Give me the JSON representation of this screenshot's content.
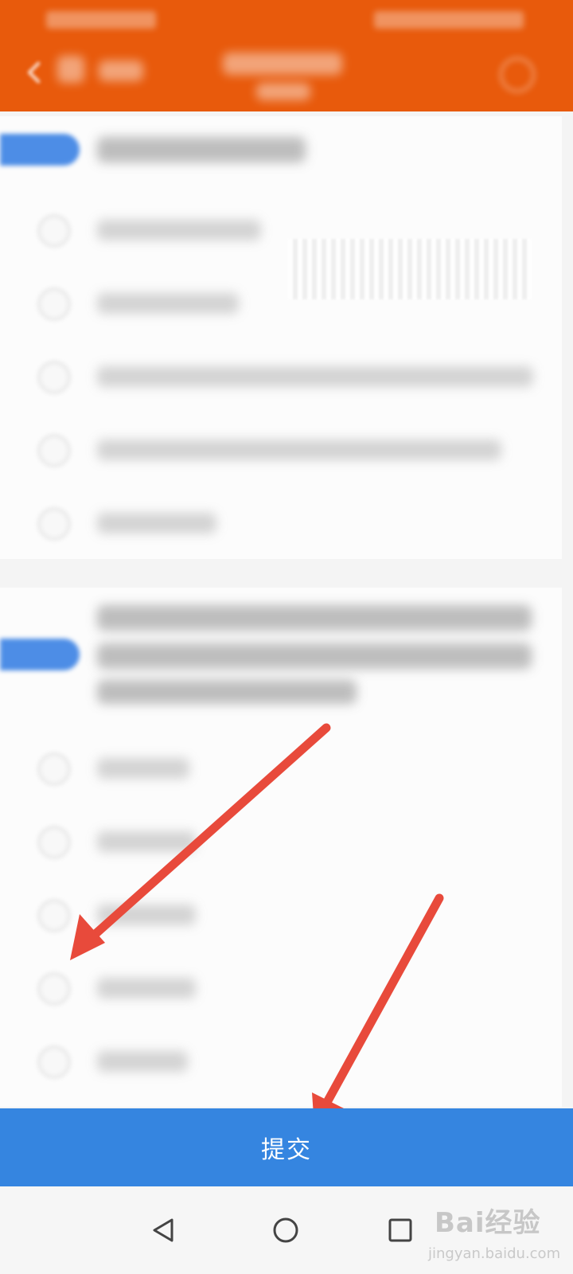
{
  "submit": {
    "label": "提交"
  },
  "watermark": {
    "logo_text": "Bai经验",
    "url_text": "jingyan.baidu.com"
  },
  "annotations": {
    "color": "#e84a3b"
  },
  "colors": {
    "header": "#e85a0c",
    "submit": "#3585e0",
    "badge": "#4d8de6"
  },
  "icons": {
    "back": "chevron-left-icon",
    "header_action": "circle-icon",
    "nav_back": "triangle-back-icon",
    "nav_home": "circle-home-icon",
    "nav_recent": "square-recent-icon"
  }
}
